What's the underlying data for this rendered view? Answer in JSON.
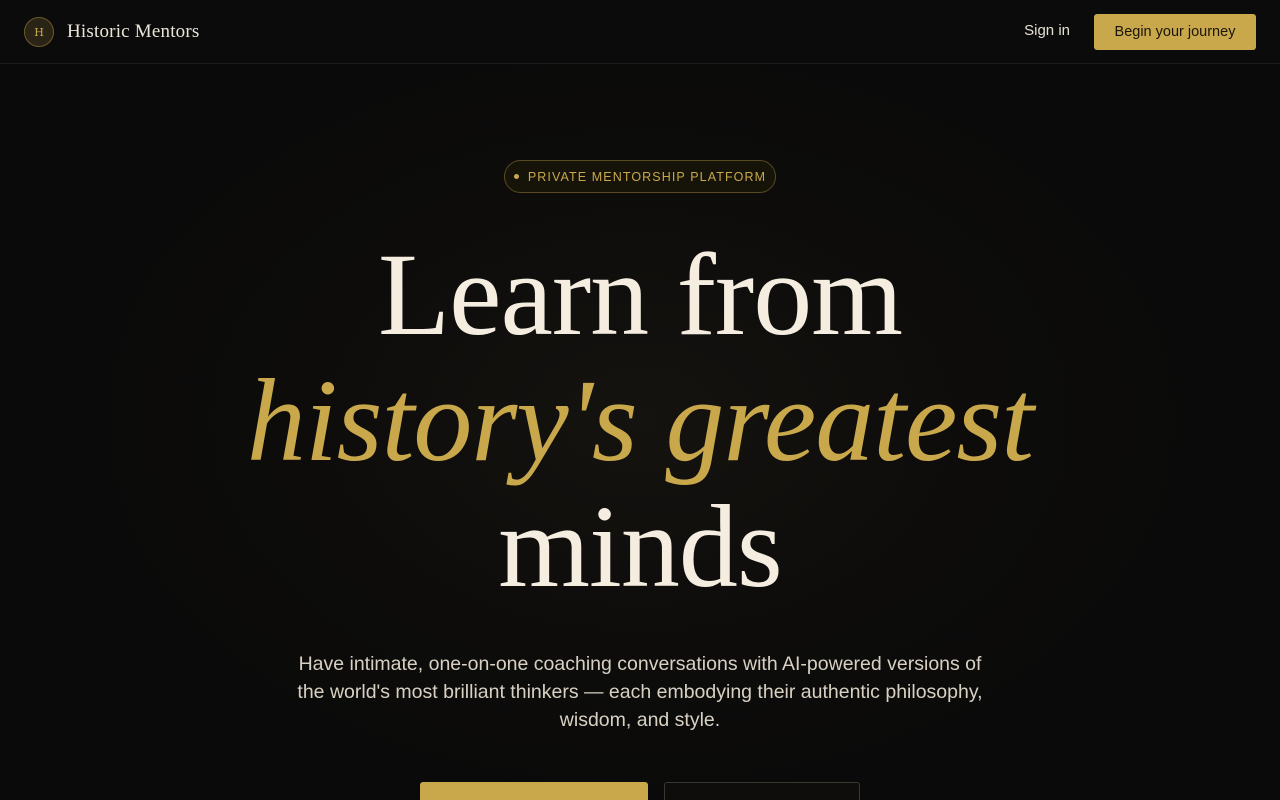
{
  "header": {
    "brand_mark": "H",
    "brand_name": "Historic Mentors",
    "sign_in_label": "Sign in",
    "cta_label": "Begin your journey"
  },
  "hero": {
    "badge_label": "PRIVATE MENTORSHIP PLATFORM",
    "headline_line1": "Learn from",
    "headline_line2": "history's greatest",
    "headline_line3": "minds",
    "subtitle": "Have intimate, one-on-one coaching conversations with AI-powered versions of the world's most brilliant thinkers — each embodying their authentic philosophy, wisdom, and style."
  },
  "colors": {
    "accent_gold": "#c9a84c",
    "background": "#0a0a0a",
    "headline_cream": "#f4ede0"
  }
}
